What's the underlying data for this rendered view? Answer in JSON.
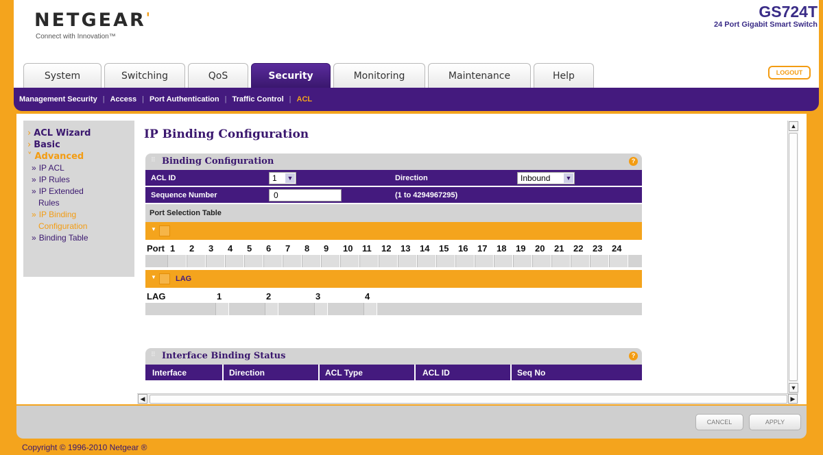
{
  "header": {
    "logo": "NETGEAR",
    "tagline": "Connect with Innovation™",
    "model": "GS724T",
    "model_sub": "24 Port Gigabit Smart Switch",
    "logout": "LOGOUT"
  },
  "tabs": [
    {
      "label": "System",
      "active": false
    },
    {
      "label": "Switching",
      "active": false
    },
    {
      "label": "QoS",
      "active": false
    },
    {
      "label": "Security",
      "active": true
    },
    {
      "label": "Monitoring",
      "active": false
    },
    {
      "label": "Maintenance",
      "active": false
    },
    {
      "label": "Help",
      "active": false
    }
  ],
  "subnav": [
    {
      "label": "Management Security",
      "active": false
    },
    {
      "label": "Access",
      "active": false
    },
    {
      "label": "Port Authentication",
      "active": false
    },
    {
      "label": "Traffic Control",
      "active": false
    },
    {
      "label": "ACL",
      "active": true
    }
  ],
  "sidebar": {
    "acl_wizard": "ACL Wizard",
    "basic": "Basic",
    "advanced": "Advanced",
    "ip_acl": "IP ACL",
    "ip_rules": "IP Rules",
    "ip_extended_1": "IP Extended",
    "ip_extended_2": "Rules",
    "ip_binding_1": "IP Binding",
    "ip_binding_2": "Configuration",
    "binding_table": "Binding Table"
  },
  "page_title": "IP Binding Configuration",
  "binding": {
    "title": "Binding Configuration",
    "acl_id_label": "ACL ID",
    "acl_id_value": "1",
    "direction_label": "Direction",
    "direction_value": "Inbound",
    "seq_label": "Sequence Number",
    "seq_value": "0",
    "seq_range": "(1 to 4294967295)",
    "port_table_label": "Port Selection Table",
    "port_label": "Port",
    "ports": [
      "1",
      "2",
      "3",
      "4",
      "5",
      "6",
      "7",
      "8",
      "9",
      "10",
      "11",
      "12",
      "13",
      "14",
      "15",
      "16",
      "17",
      "18",
      "19",
      "20",
      "21",
      "22",
      "23",
      "24"
    ],
    "lag_section": "LAG",
    "lag_label": "LAG",
    "lags": [
      "1",
      "2",
      "3",
      "4"
    ]
  },
  "status": {
    "title": "Interface Binding Status",
    "columns": [
      "Interface",
      "Direction",
      "ACL Type",
      "ACL ID",
      "Seq No"
    ]
  },
  "footer": {
    "cancel": "CANCEL",
    "apply": "APPLY",
    "copyright": "Copyright © 1996-2010 Netgear ®"
  },
  "colors": {
    "accent_orange": "#f4a41d",
    "brand_purple": "#441a7e"
  }
}
